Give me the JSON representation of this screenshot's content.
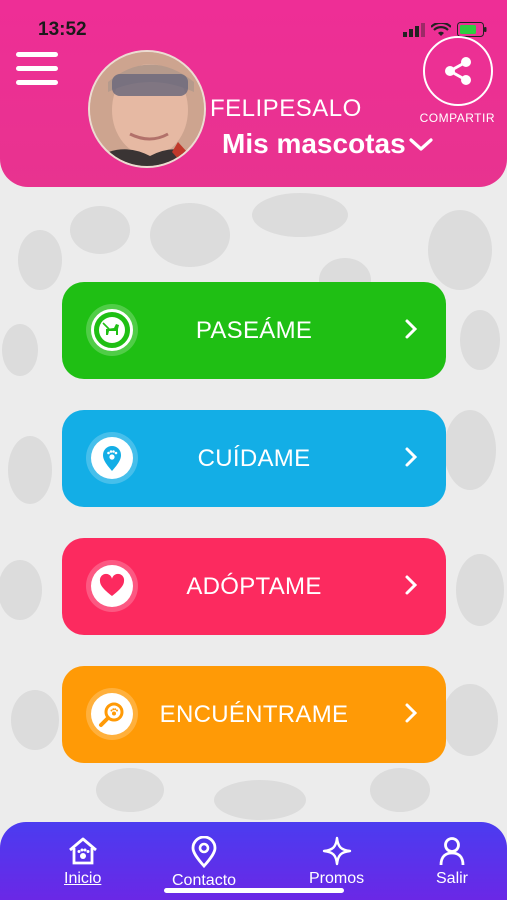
{
  "status_bar": {
    "time": "13:52"
  },
  "header": {
    "username": "FELIPESALO",
    "pets_selector": "Mis mascotas",
    "share_label": "COMPARTIR"
  },
  "menu": [
    {
      "label": "PASEÁME",
      "color": "#1fbf14",
      "icon": "dog-walk-icon"
    },
    {
      "label": "CUÍDAME",
      "color": "#13aee6",
      "icon": "location-paw-icon"
    },
    {
      "label": "ADÓPTAME",
      "color": "#fc2a5f",
      "icon": "heart-icon"
    },
    {
      "label": "ENCUÉNTRAME",
      "color": "#ff9a06",
      "icon": "search-paw-icon"
    }
  ],
  "nav": {
    "items": [
      {
        "label": "Inicio",
        "icon": "home-paw-icon",
        "active": true
      },
      {
        "label": "Contacto",
        "icon": "map-pin-icon"
      },
      {
        "label": "Promos",
        "icon": "sparkle-icon"
      },
      {
        "label": "Salir",
        "icon": "user-icon"
      }
    ]
  },
  "colors": {
    "header": "#ee2e96",
    "nav": "#5a33ec"
  }
}
